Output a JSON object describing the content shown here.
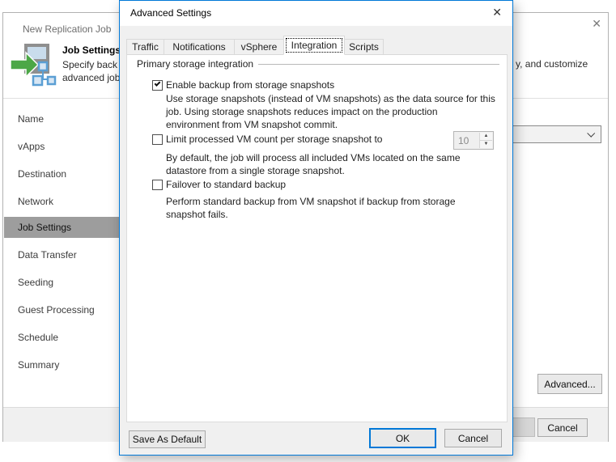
{
  "window": {
    "title": "New Replication Job",
    "header": {
      "step_title": "Job Settings",
      "desc_left_line1": "Specify back",
      "desc_left_line2": "advanced job",
      "desc_right": "y, and customize"
    },
    "sidebar": {
      "items": [
        "Name",
        "vApps",
        "Destination",
        "Network",
        "Job Settings",
        "Data Transfer",
        "Seeding",
        "Guest Processing",
        "Schedule",
        "Summary"
      ],
      "selected": "Job Settings"
    },
    "buttons": {
      "advanced": "Advanced...",
      "cancel": "Cancel"
    }
  },
  "dialog": {
    "title": "Advanced Settings",
    "tabs": [
      "Traffic",
      "Notifications",
      "vSphere",
      "Integration",
      "Scripts"
    ],
    "active_tab": "Integration",
    "group_title": "Primary storage integration",
    "options": {
      "enable_backup": {
        "label": "Enable backup from storage snapshots",
        "checked": true,
        "description_lines": [
          "Use storage snapshots (instead of VM snapshots) as the data source for this",
          "job. Using storage snapshots reduces impact on the production",
          "environment from VM snapshot commit."
        ]
      },
      "limit_vm_count": {
        "label": "Limit processed VM count per storage snapshot to",
        "checked": false,
        "value": "10",
        "description_lines": [
          "By default, the job will process all included VMs located on the same",
          "datastore from a single storage snapshot."
        ]
      },
      "failover": {
        "label": "Failover to standard backup",
        "checked": false,
        "description_lines": [
          "Perform standard backup from VM snapshot if backup from storage",
          "snapshot fails."
        ]
      }
    },
    "buttons": {
      "save_default": "Save As Default",
      "ok": "OK",
      "cancel": "Cancel"
    }
  },
  "icons": {
    "close": "✕",
    "spin_up": "▲",
    "spin_down": "▼"
  },
  "colors": {
    "accent": "#0078d7",
    "selected_step_bg": "#9d9d9d",
    "dialog_bg": "#f0f0f0"
  }
}
